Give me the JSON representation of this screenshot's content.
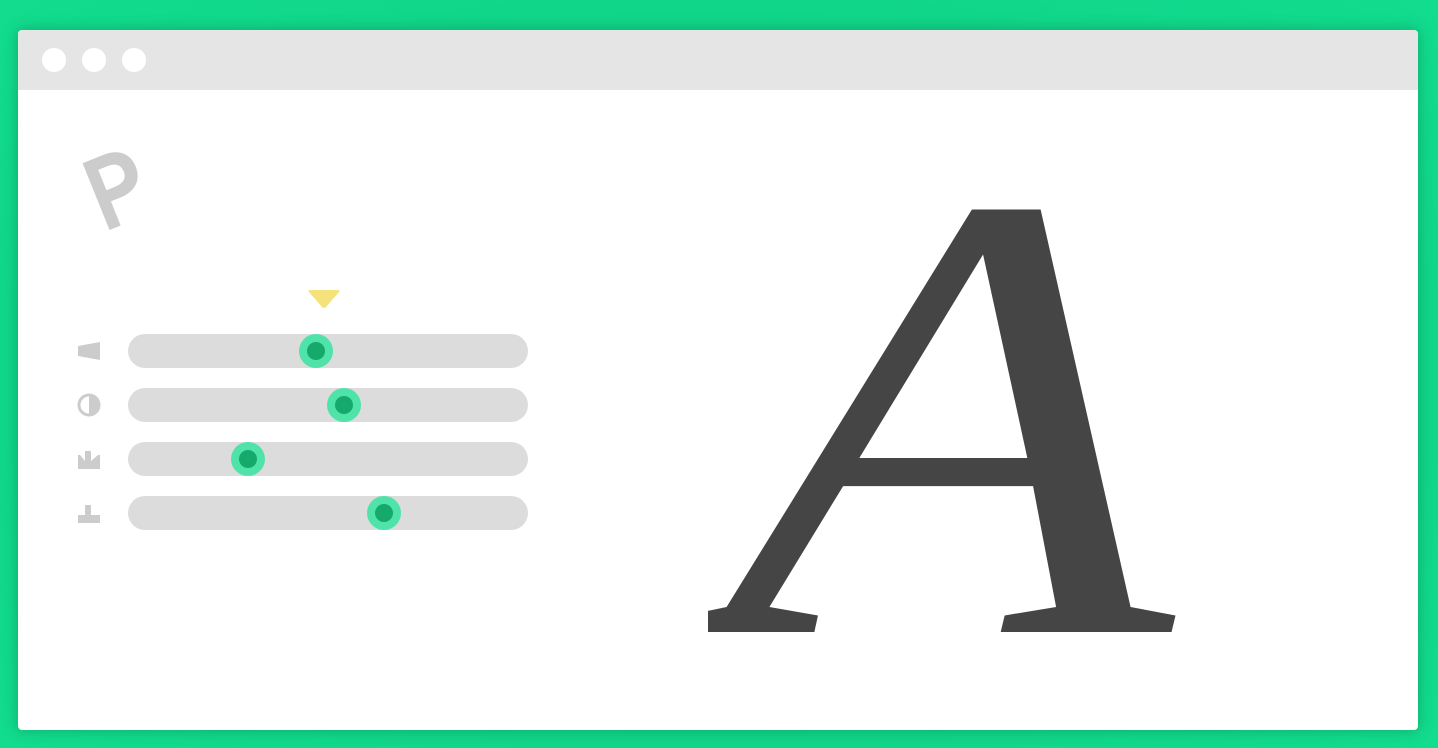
{
  "window": {
    "title_controls": [
      "close",
      "minimize",
      "maximize"
    ]
  },
  "logo": {
    "icon": "p-logo-icon",
    "color": "#cccccc"
  },
  "marker": {
    "icon": "triangle-down-icon",
    "color": "#f5e27a"
  },
  "sliders": [
    {
      "name": "width",
      "icon": "width-wedge-icon",
      "value": 0.47
    },
    {
      "name": "contrast",
      "icon": "contrast-half-circle-icon",
      "value": 0.54
    },
    {
      "name": "serif-bottom",
      "icon": "serif-bottom-icon",
      "value": 0.3
    },
    {
      "name": "serif-top",
      "icon": "serif-top-icon",
      "value": 0.64
    }
  ],
  "preview": {
    "glyph": "A",
    "color": "#454545"
  },
  "colors": {
    "background": "#10d488",
    "track": "#dcdcdc",
    "thumb_outer": "#4fe3a9",
    "thumb_inner": "#15a96b",
    "icon": "#cccccc"
  }
}
